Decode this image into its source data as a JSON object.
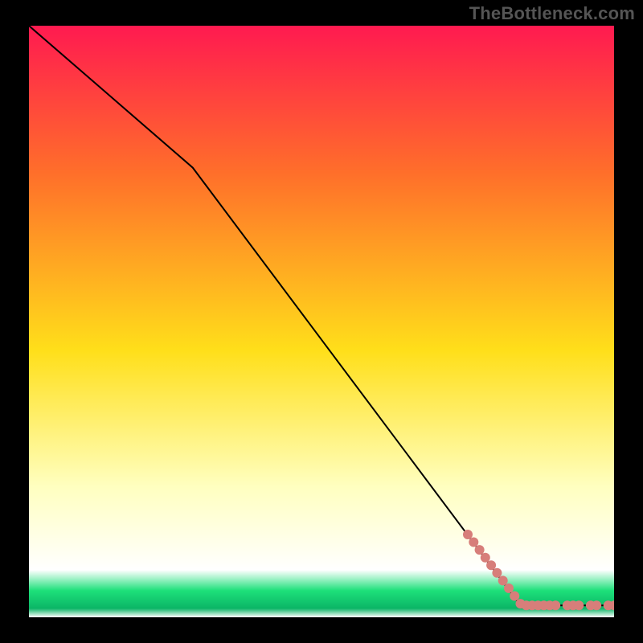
{
  "watermark": "TheBottleneck.com",
  "colors": {
    "bg_black": "#000000",
    "line": "#000000",
    "point_fill": "#d77e7a",
    "grad_top": "#ff1a50",
    "grad_mid_upper": "#ff6f2a",
    "grad_mid": "#ffdf1a",
    "grad_pale": "#ffffc0",
    "grad_green": "#1de07a",
    "grad_green_dark": "#0bb566",
    "watermark": "#555555"
  },
  "chart_data": {
    "type": "line",
    "title": "",
    "xlabel": "",
    "ylabel": "",
    "xlim": [
      0,
      100
    ],
    "ylim": [
      0,
      100
    ],
    "series": [
      {
        "name": "curve",
        "x": [
          0,
          28,
          84,
          100
        ],
        "y": [
          100,
          76,
          2,
          2
        ]
      }
    ],
    "points": {
      "name": "markers",
      "x": [
        75,
        76,
        77,
        78,
        79,
        80,
        81,
        82,
        83,
        84,
        85,
        86,
        87,
        88,
        89,
        90,
        92,
        93,
        94,
        96,
        97,
        99,
        100
      ],
      "y": [
        14,
        12.7,
        11.4,
        10.1,
        8.8,
        7.5,
        6.2,
        4.9,
        3.6,
        2.3,
        2,
        2,
        2,
        2,
        2,
        2,
        2,
        2,
        2,
        2,
        2,
        2,
        2
      ]
    },
    "gradient_stops": [
      {
        "offset": 0.0,
        "color": "#ff1a50"
      },
      {
        "offset": 0.25,
        "color": "#ff6f2a"
      },
      {
        "offset": 0.55,
        "color": "#ffdf1a"
      },
      {
        "offset": 0.78,
        "color": "#ffffc0"
      },
      {
        "offset": 0.92,
        "color": "#ffffff"
      },
      {
        "offset": 0.955,
        "color": "#1de07a"
      },
      {
        "offset": 0.985,
        "color": "#0bb566"
      },
      {
        "offset": 1.0,
        "color": "#ffffff"
      }
    ]
  }
}
